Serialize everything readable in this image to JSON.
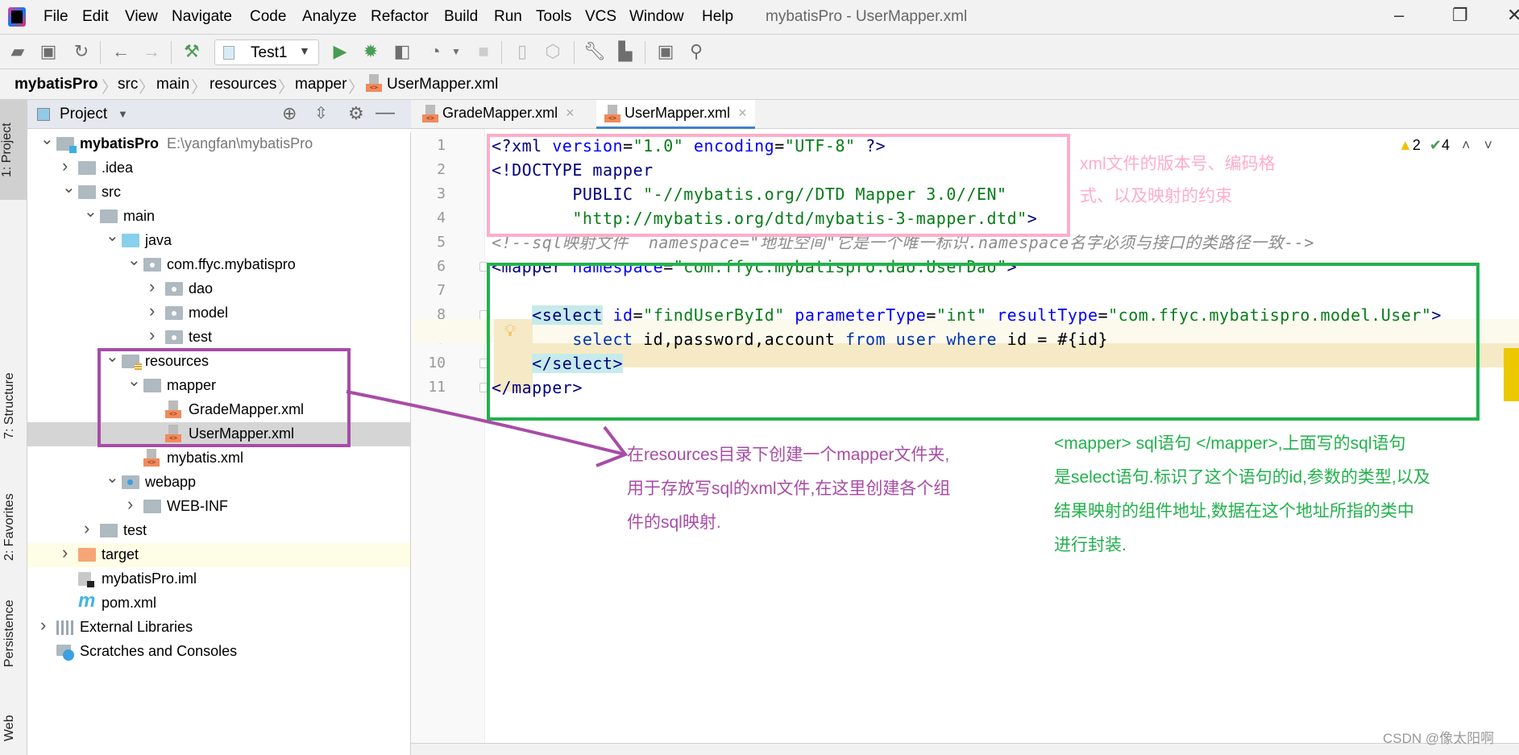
{
  "window": {
    "title": "mybatisPro - UserMapper.xml",
    "controls": [
      "minimize-icon",
      "restore-icon",
      "close-icon"
    ]
  },
  "menu": [
    "File",
    "Edit",
    "View",
    "Navigate",
    "Code",
    "Analyze",
    "Refactor",
    "Build",
    "Run",
    "Tools",
    "VCS",
    "Window",
    "Help"
  ],
  "toolbar": {
    "run_config": "Test1",
    "icons": [
      "open-icon",
      "save-icon",
      "sync-icon",
      "back-icon",
      "forward-icon",
      "build-icon",
      "run-icon",
      "debug-icon",
      "coverage-icon",
      "profile-icon",
      "stop-icon",
      "device-icon",
      "deploy-icon",
      "settings-wrench-icon",
      "project-structure-icon",
      "terminal-icon",
      "search-icon"
    ]
  },
  "breadcrumb": [
    "mybatisPro",
    "src",
    "main",
    "resources",
    "mapper",
    "UserMapper.xml"
  ],
  "left_strip": [
    "1: Project",
    "7: Structure",
    "2: Favorites",
    "Persistence",
    "Web"
  ],
  "project_panel": {
    "title": "Project",
    "tree": [
      {
        "label": "mybatisPro",
        "path": "E:\\yangfan\\mybatisPro",
        "level": 0,
        "state": "expanded",
        "icon": "mod",
        "bold": true
      },
      {
        "label": ".idea",
        "level": 1,
        "state": "collapsed",
        "icon": "folder"
      },
      {
        "label": "src",
        "level": 1,
        "state": "expanded",
        "icon": "folder"
      },
      {
        "label": "main",
        "level": 2,
        "state": "expanded",
        "icon": "folder"
      },
      {
        "label": "java",
        "level": 3,
        "state": "expanded",
        "icon": "blue"
      },
      {
        "label": "com.ffyc.mybatispro",
        "level": 4,
        "state": "expanded",
        "icon": "pkg"
      },
      {
        "label": "dao",
        "level": 5,
        "state": "collapsed",
        "icon": "pkg"
      },
      {
        "label": "model",
        "level": 5,
        "state": "collapsed",
        "icon": "pkg"
      },
      {
        "label": "test",
        "level": 5,
        "state": "collapsed",
        "icon": "pkg"
      },
      {
        "label": "resources",
        "level": 3,
        "state": "expanded",
        "icon": "res"
      },
      {
        "label": "mapper",
        "level": 4,
        "state": "expanded",
        "icon": "folder"
      },
      {
        "label": "GradeMapper.xml",
        "level": 5,
        "state": "leaf",
        "icon": "xml"
      },
      {
        "label": "UserMapper.xml",
        "level": 5,
        "state": "leaf",
        "icon": "xml",
        "selected": true
      },
      {
        "label": "mybatis.xml",
        "level": 4,
        "state": "leaf",
        "icon": "xml"
      },
      {
        "label": "webapp",
        "level": 3,
        "state": "expanded",
        "icon": "web"
      },
      {
        "label": "WEB-INF",
        "level": 4,
        "state": "collapsed",
        "icon": "folder"
      },
      {
        "label": "test",
        "level": 2,
        "state": "collapsed",
        "icon": "folder"
      },
      {
        "label": "target",
        "level": 1,
        "state": "collapsed",
        "icon": "orange",
        "highlighted": true
      },
      {
        "label": "mybatisPro.iml",
        "level": 1,
        "state": "leaf",
        "icon": "iml"
      },
      {
        "label": "pom.xml",
        "level": 1,
        "state": "leaf",
        "icon": "mvn"
      },
      {
        "label": "External Libraries",
        "level": 0,
        "state": "collapsed",
        "icon": "lib"
      },
      {
        "label": "Scratches and Consoles",
        "level": 0,
        "state": "leaf",
        "icon": "scr"
      }
    ]
  },
  "editor": {
    "tabs": [
      {
        "label": "GradeMapper.xml",
        "active": false
      },
      {
        "label": "UserMapper.xml",
        "active": true
      }
    ],
    "inspections": {
      "warnings": "2",
      "weak_warnings": "4"
    },
    "lines": [
      [
        {
          "t": "<?",
          "c": "tag"
        },
        {
          "t": "xml ",
          "c": "tag"
        },
        {
          "t": "version",
          "c": "attr"
        },
        {
          "t": "=",
          "c": "txt"
        },
        {
          "t": "\"1.0\"",
          "c": "val"
        },
        {
          "t": " ",
          "c": "txt"
        },
        {
          "t": "encoding",
          "c": "attr"
        },
        {
          "t": "=",
          "c": "txt"
        },
        {
          "t": "\"UTF-8\"",
          "c": "val"
        },
        {
          "t": " ?>",
          "c": "tag"
        }
      ],
      [
        {
          "t": "<!DOCTYPE mapper",
          "c": "tag"
        }
      ],
      [
        {
          "t": "        PUBLIC ",
          "c": "tag"
        },
        {
          "t": "\"-//mybatis.org//DTD Mapper 3.0//EN\"",
          "c": "val"
        }
      ],
      [
        {
          "t": "        \"http://mybatis.org/dtd/mybatis-3-mapper.dtd\"",
          "c": "val"
        },
        {
          "t": ">",
          "c": "tag"
        }
      ],
      [
        {
          "t": "<!--sql映射文件  namespace=\"地址空间\"它是一个唯一标识.namespace名字必须与接口的类路径一致-->",
          "c": "cm"
        }
      ],
      [
        {
          "t": "<mapper ",
          "c": "tag"
        },
        {
          "t": "namespace",
          "c": "attr"
        },
        {
          "t": "=",
          "c": "txt"
        },
        {
          "t": "\"com.ffyc.mybatispro.dao.UserDao\"",
          "c": "val"
        },
        {
          "t": ">",
          "c": "tag"
        }
      ],
      [],
      [
        {
          "t": "    ",
          "c": "txt"
        },
        {
          "t": "<select",
          "c": "tag match"
        },
        {
          "t": " ",
          "c": "txt"
        },
        {
          "t": "id",
          "c": "attr"
        },
        {
          "t": "=",
          "c": "txt"
        },
        {
          "t": "\"findUserById\"",
          "c": "val"
        },
        {
          "t": " ",
          "c": "txt"
        },
        {
          "t": "parameterType",
          "c": "attr"
        },
        {
          "t": "=",
          "c": "txt"
        },
        {
          "t": "\"int\"",
          "c": "val"
        },
        {
          "t": " ",
          "c": "txt"
        },
        {
          "t": "resultType",
          "c": "attr"
        },
        {
          "t": "=",
          "c": "txt"
        },
        {
          "t": "\"com.ffyc.mybatispro.model.User\"",
          "c": "val"
        },
        {
          "t": ">",
          "c": "tag"
        }
      ],
      [
        {
          "t": "        ",
          "c": "txt"
        },
        {
          "t": "select ",
          "c": "sql"
        },
        {
          "t": "id,password,account ",
          "c": "id"
        },
        {
          "t": "from ",
          "c": "sql"
        },
        {
          "t": "user ",
          "c": "sql"
        },
        {
          "t": "where ",
          "c": "sql"
        },
        {
          "t": "id = #{id}",
          "c": "id"
        }
      ],
      [
        {
          "t": "    ",
          "c": "txt"
        },
        {
          "t": "</select>",
          "c": "tag match"
        }
      ],
      [
        {
          "t": "</mapper>",
          "c": "tag"
        }
      ]
    ]
  },
  "annotations": {
    "pink": [
      "xml文件的版本号、编码格",
      "式、以及映射的约束"
    ],
    "purple": [
      "在resources目录下创建一个mapper文件夹,",
      "用于存放写sql的xml文件,在这里创建各个组",
      "件的sql映射."
    ],
    "green": [
      "<mapper> sql语句 </mapper>,上面写的sql语句",
      "是select语句.标识了这个语句的id,参数的类型,以及",
      "结果映射的组件地址,数据在这个地址所指的类中",
      " 进行封装."
    ],
    "colors": {
      "pink": "#ffadc9",
      "purple": "#a84ca6",
      "green": "#22b14c"
    }
  },
  "watermark": "CSDN @像太阳啊"
}
